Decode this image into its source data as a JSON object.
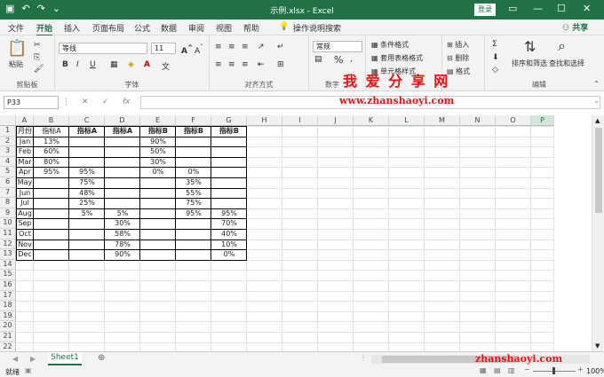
{
  "window": {
    "title": "示例.xlsx  -  Excel",
    "login": "登录",
    "share": "共享",
    "help_search": "操作说明搜索"
  },
  "quick_access": {
    "save_icon": "save-icon",
    "undo_icon": "undo-icon",
    "redo_icon": "redo-icon"
  },
  "menu_tabs": [
    "文件",
    "开始",
    "插入",
    "页面布局",
    "公式",
    "数据",
    "审阅",
    "视图",
    "帮助"
  ],
  "active_tab": "开始",
  "ribbon": {
    "paste": "粘贴",
    "clipboard": "剪贴板",
    "font_name": "等线",
    "font_size": "11",
    "font_group": "字体",
    "align_group": "对齐方式",
    "number_format": "常规",
    "number_group": "数字",
    "cond_format": "条件格式",
    "table_format": "套用表格格式",
    "cell_style": "单元格样式",
    "style_group": "样式",
    "insert": "插入",
    "delete": "删除",
    "format": "格式",
    "cells_group": "单元格",
    "sort_filter": "排序和筛选",
    "find_select": "查找和选择",
    "edit_group": "编辑",
    "font_buttons": [
      "B",
      "I",
      "U"
    ]
  },
  "watermark": {
    "cn": "我 爱 分 享 网",
    "url": "www.zhanshaoyi.com",
    "bottom": "zhanshaoyi.com"
  },
  "formula_bar": {
    "namebox": "P33",
    "fx": "fx",
    "cancel": "✕",
    "enter": "✓"
  },
  "columns": [
    "A",
    "B",
    "C",
    "D",
    "E",
    "F",
    "G",
    "H",
    "I",
    "J",
    "K",
    "L",
    "M",
    "N",
    "O",
    "P"
  ],
  "row_numbers": [
    "1",
    "2",
    "3",
    "4",
    "5",
    "6",
    "7",
    "8",
    "9",
    "10",
    "11",
    "12",
    "13",
    "14",
    "15",
    "16",
    "17",
    "18",
    "19",
    "20",
    "21",
    "22"
  ],
  "table": {
    "header": [
      "月份",
      "指标A",
      "指标A",
      "指标A",
      "指标B",
      "指标B",
      "指标B"
    ],
    "rows": [
      [
        "Jan",
        "13%",
        "",
        "",
        "90%",
        "",
        ""
      ],
      [
        "Feb",
        "60%",
        "",
        "",
        "50%",
        "",
        ""
      ],
      [
        "Mar",
        "80%",
        "",
        "",
        "30%",
        "",
        ""
      ],
      [
        "Apr",
        "95%",
        "95%",
        "",
        "0%",
        "0%",
        ""
      ],
      [
        "May",
        "",
        "75%",
        "",
        "",
        "35%",
        ""
      ],
      [
        "Jun",
        "",
        "48%",
        "",
        "",
        "55%",
        ""
      ],
      [
        "Jul",
        "",
        "25%",
        "",
        "",
        "75%",
        ""
      ],
      [
        "Aug",
        "",
        "5%",
        "5%",
        "",
        "95%",
        "95%"
      ],
      [
        "Sep",
        "",
        "",
        "30%",
        "",
        "",
        "70%"
      ],
      [
        "Oct",
        "",
        "",
        "58%",
        "",
        "",
        "40%"
      ],
      [
        "Nov",
        "",
        "",
        "78%",
        "",
        "",
        "10%"
      ],
      [
        "Dec",
        "",
        "",
        "90%",
        "",
        "",
        "0%"
      ]
    ]
  },
  "sheet_tab": "Sheet1",
  "status": {
    "ready": "就绪",
    "zoom": "100%"
  }
}
